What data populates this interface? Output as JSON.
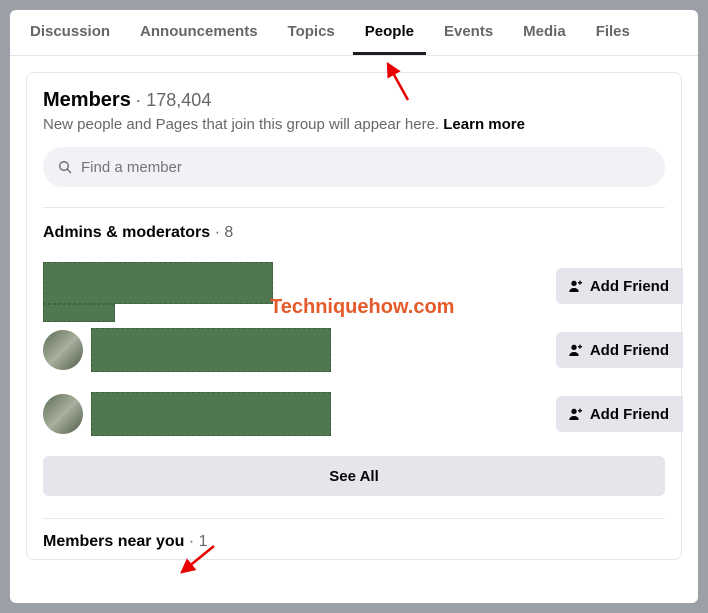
{
  "tabs": [
    "Discussion",
    "Announcements",
    "Topics",
    "People",
    "Events",
    "Media",
    "Files"
  ],
  "active_tab_index": 3,
  "members": {
    "title": "Members",
    "count": "178,404",
    "description_prefix": "New people and Pages that join this group will appear here. ",
    "learn_more": "Learn more",
    "search_placeholder": "Find a member"
  },
  "admins": {
    "title": "Admins & moderators",
    "count": "8",
    "add_friend_label": "Add Friend",
    "see_all_label": "See All"
  },
  "near_you": {
    "title": "Members near you",
    "count": "1"
  },
  "watermark": "Techniquehow.com"
}
